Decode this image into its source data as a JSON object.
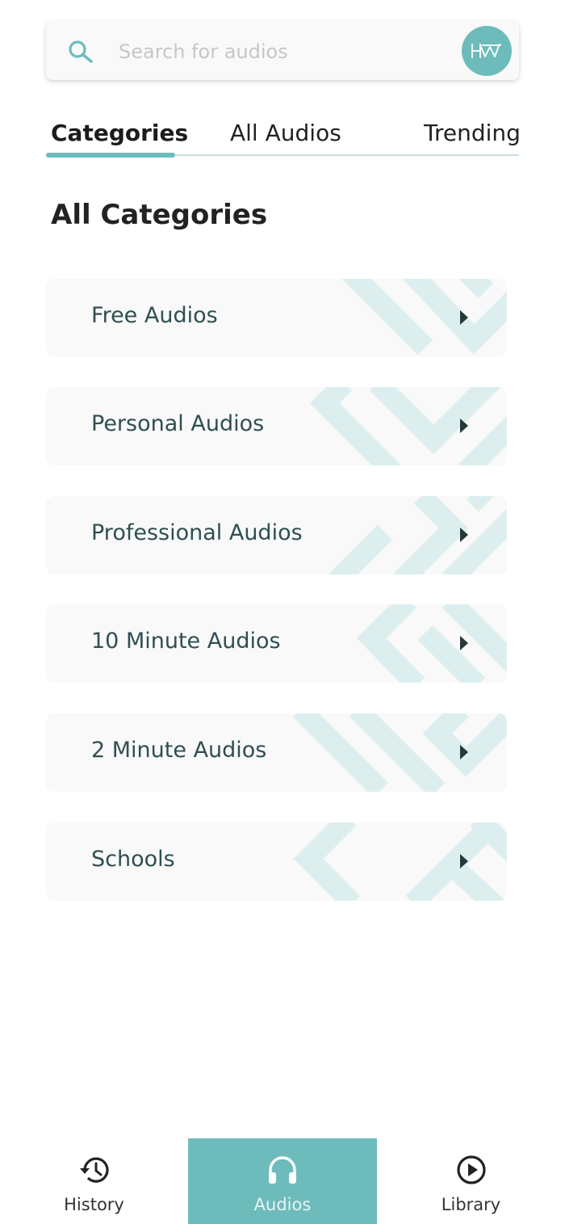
{
  "search": {
    "placeholder": "Search for audios",
    "value": "",
    "logo_text": "HW"
  },
  "tabs": [
    {
      "label": "Categories",
      "active": true
    },
    {
      "label": "All Audios",
      "active": false
    },
    {
      "label": "Trending",
      "active": false
    }
  ],
  "section_title": "All Categories",
  "categories": [
    {
      "label": "Free Audios",
      "icon": "play-arrow-icon"
    },
    {
      "label": "Personal Audios",
      "icon": "play-arrow-icon"
    },
    {
      "label": "Professional Audios",
      "icon": "play-arrow-icon"
    },
    {
      "label": "10 Minute Audios",
      "icon": "play-arrow-icon"
    },
    {
      "label": "2 Minute Audios",
      "icon": "play-arrow-icon"
    },
    {
      "label": "Schools",
      "icon": "play-arrow-icon"
    }
  ],
  "bottom_nav": [
    {
      "label": "History",
      "icon": "history-icon",
      "active": false
    },
    {
      "label": "Audios",
      "icon": "headphones-icon",
      "active": true
    },
    {
      "label": "Library",
      "icon": "play-circle-icon",
      "active": false
    }
  ],
  "colors": {
    "accent": "#6dbcbb",
    "pattern": "#dcefee",
    "card_bg": "#f9f9f9",
    "text": "#2f4f51"
  }
}
